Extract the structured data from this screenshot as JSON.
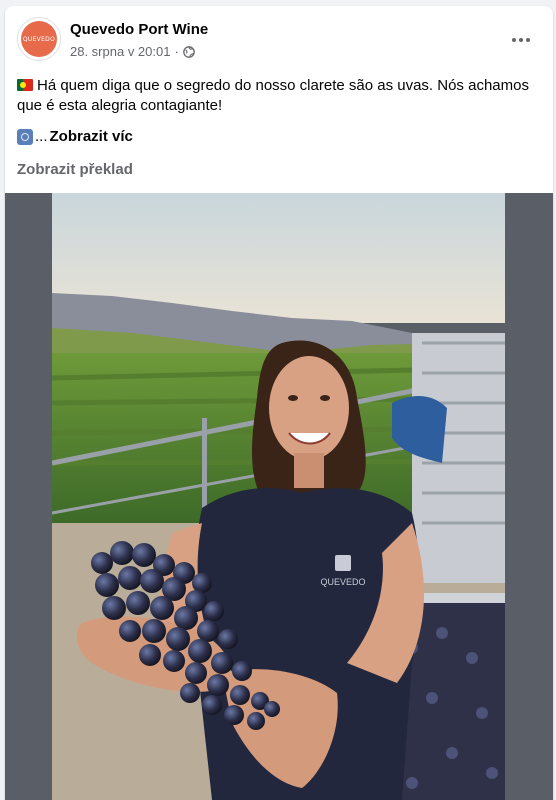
{
  "post": {
    "page_name": "Quevedo Port Wine",
    "avatar_text": "QUEVEDO",
    "timestamp": "28. srpna v 20:01",
    "separator": "·",
    "audience_icon": "globe-icon",
    "text": "Há quem diga que o segredo do nosso clarete são as uvas. Nós achamos que é esta alegria contagiante!",
    "ellipsis": "...",
    "see_more": "Zobrazit víc",
    "translate": "Zobrazit překlad",
    "shirt_logo": "QUEVEDO"
  },
  "colors": {
    "background": "#f0f2f5",
    "card": "#ffffff",
    "primary_text": "#050505",
    "secondary_text": "#65676b",
    "avatar_accent": "#e76a4a",
    "media_sidebar": "#5a5e66"
  },
  "icons": {
    "flag": "portugal-flag-icon",
    "emoji": "emoji-icon",
    "more": "more-options-icon"
  }
}
